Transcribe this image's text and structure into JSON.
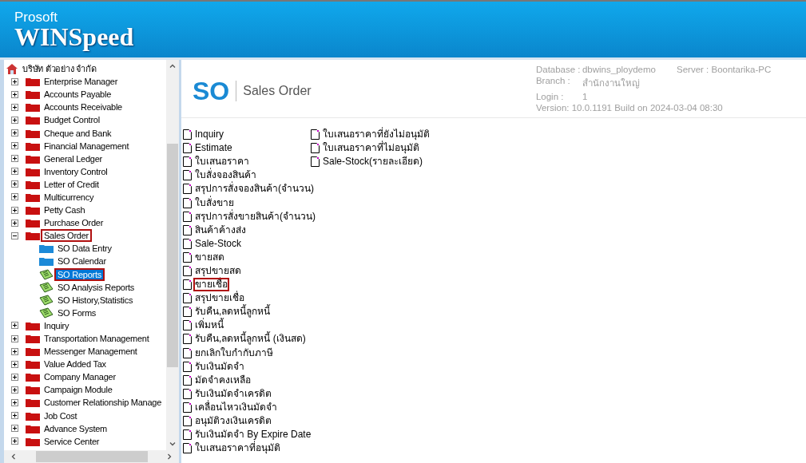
{
  "header": {
    "brand": "Prosoft",
    "product": "WINSpeed"
  },
  "tree": {
    "root": "บริษัท ตัวอย่าง จำกัด",
    "items": [
      {
        "label": "Enterprise Manager",
        "expanded": false,
        "highlighted": false
      },
      {
        "label": "Accounts Payable",
        "expanded": false,
        "highlighted": false
      },
      {
        "label": "Accounts Receivable",
        "expanded": false,
        "highlighted": false
      },
      {
        "label": "Budget Control",
        "expanded": false,
        "highlighted": false
      },
      {
        "label": "Cheque and Bank",
        "expanded": false,
        "highlighted": false
      },
      {
        "label": "Financial Management",
        "expanded": false,
        "highlighted": false
      },
      {
        "label": "General Ledger",
        "expanded": false,
        "highlighted": false
      },
      {
        "label": "Inventory Control",
        "expanded": false,
        "highlighted": false
      },
      {
        "label": "Letter of Credit",
        "expanded": false,
        "highlighted": false
      },
      {
        "label": "Multicurrency",
        "expanded": false,
        "highlighted": false
      },
      {
        "label": "Petty Cash",
        "expanded": false,
        "highlighted": false
      },
      {
        "label": "Purchase Order",
        "expanded": false,
        "highlighted": false
      },
      {
        "label": "Sales Order",
        "expanded": true,
        "highlighted": true,
        "children": [
          {
            "label": "SO Data Entry",
            "kind": "entry",
            "selected": false,
            "highlighted": false
          },
          {
            "label": "SO Calendar",
            "kind": "entry",
            "selected": false,
            "highlighted": false
          },
          {
            "label": "SO Reports",
            "kind": "report",
            "selected": true,
            "highlighted": true
          },
          {
            "label": "SO Analysis Reports",
            "kind": "report",
            "selected": false,
            "highlighted": false
          },
          {
            "label": "SO History,Statistics",
            "kind": "report",
            "selected": false,
            "highlighted": false
          },
          {
            "label": "SO Forms",
            "kind": "report",
            "selected": false,
            "highlighted": false
          }
        ]
      },
      {
        "label": "Inquiry",
        "expanded": false,
        "highlighted": false
      },
      {
        "label": "Transportation Management",
        "expanded": false,
        "highlighted": false
      },
      {
        "label": "Messenger Management",
        "expanded": false,
        "highlighted": false
      },
      {
        "label": "Value Added Tax",
        "expanded": false,
        "highlighted": false
      },
      {
        "label": "Company Manager",
        "expanded": false,
        "highlighted": false
      },
      {
        "label": "Campaign Module",
        "expanded": false,
        "highlighted": false
      },
      {
        "label": "Customer Relationship Manage",
        "expanded": false,
        "highlighted": false
      },
      {
        "label": "Job Cost",
        "expanded": false,
        "highlighted": false
      },
      {
        "label": "Advance System",
        "expanded": false,
        "highlighted": false
      },
      {
        "label": "Service Center",
        "expanded": false,
        "highlighted": false
      }
    ]
  },
  "module": {
    "code": "SO",
    "title": "Sales Order"
  },
  "info": {
    "database_label": "Database :",
    "database": "dbwins_ploydemo",
    "server_label": "Server :",
    "server": "Boontarika-PC",
    "branch_label": "Branch :",
    "branch": "สำนักงานใหญ่",
    "login_label": "Login :",
    "login": "1",
    "version": "Version: 10.0.1191  Build on 2024-03-04 08:30"
  },
  "reports": [
    [
      {
        "label": "Inquiry",
        "highlighted": false
      },
      {
        "label": "Estimate",
        "highlighted": false
      },
      {
        "label": "ใบเสนอราคา",
        "highlighted": false
      },
      {
        "label": "ใบสั่งจองสินค้า",
        "highlighted": false
      },
      {
        "label": "สรุปการสั่งจองสินค้า(จำนวน)",
        "highlighted": false
      },
      {
        "label": "ใบสั่งขาย",
        "highlighted": false
      },
      {
        "label": "สรุปการสั่งขายสินค้า(จำนวน)",
        "highlighted": false
      },
      {
        "label": "สินค้าค้างส่ง",
        "highlighted": false
      },
      {
        "label": "Sale-Stock",
        "highlighted": false
      },
      {
        "label": "ขายสด",
        "highlighted": false
      },
      {
        "label": "สรุปขายสด",
        "highlighted": false
      },
      {
        "label": "ขายเชื่อ",
        "highlighted": true
      },
      {
        "label": "สรุปขายเชื่อ",
        "highlighted": false
      },
      {
        "label": "รับคืน,ลดหนี้ลูกหนี้",
        "highlighted": false
      },
      {
        "label": "เพิ่มหนี้",
        "highlighted": false
      },
      {
        "label": "รับคืน,ลดหนี้ลูกหนี้ (เงินสด)",
        "highlighted": false
      },
      {
        "label": "ยกเลิกใบกำกับภาษี",
        "highlighted": false
      },
      {
        "label": "รับเงินมัดจำ",
        "highlighted": false
      },
      {
        "label": "มัดจำคงเหลือ",
        "highlighted": false
      },
      {
        "label": "รับเงินมัดจำเครดิต",
        "highlighted": false
      },
      {
        "label": "เคลื่อนไหวเงินมัดจำ",
        "highlighted": false
      },
      {
        "label": "อนุมัติวงเงินเครดิต",
        "highlighted": false
      },
      {
        "label": "รับเงินมัดจำ By Expire Date",
        "highlighted": false
      },
      {
        "label": "ใบเสนอราคาที่อนุมัติ",
        "highlighted": false
      }
    ],
    [
      {
        "label": "ใบเสนอราคาที่ยังไม่อนุมัติ",
        "highlighted": false
      },
      {
        "label": "ใบเสนอราคาที่ไม่อนุมัติ",
        "highlighted": false
      },
      {
        "label": "Sale-Stock(รายละเอียด)",
        "highlighted": false
      }
    ]
  ]
}
